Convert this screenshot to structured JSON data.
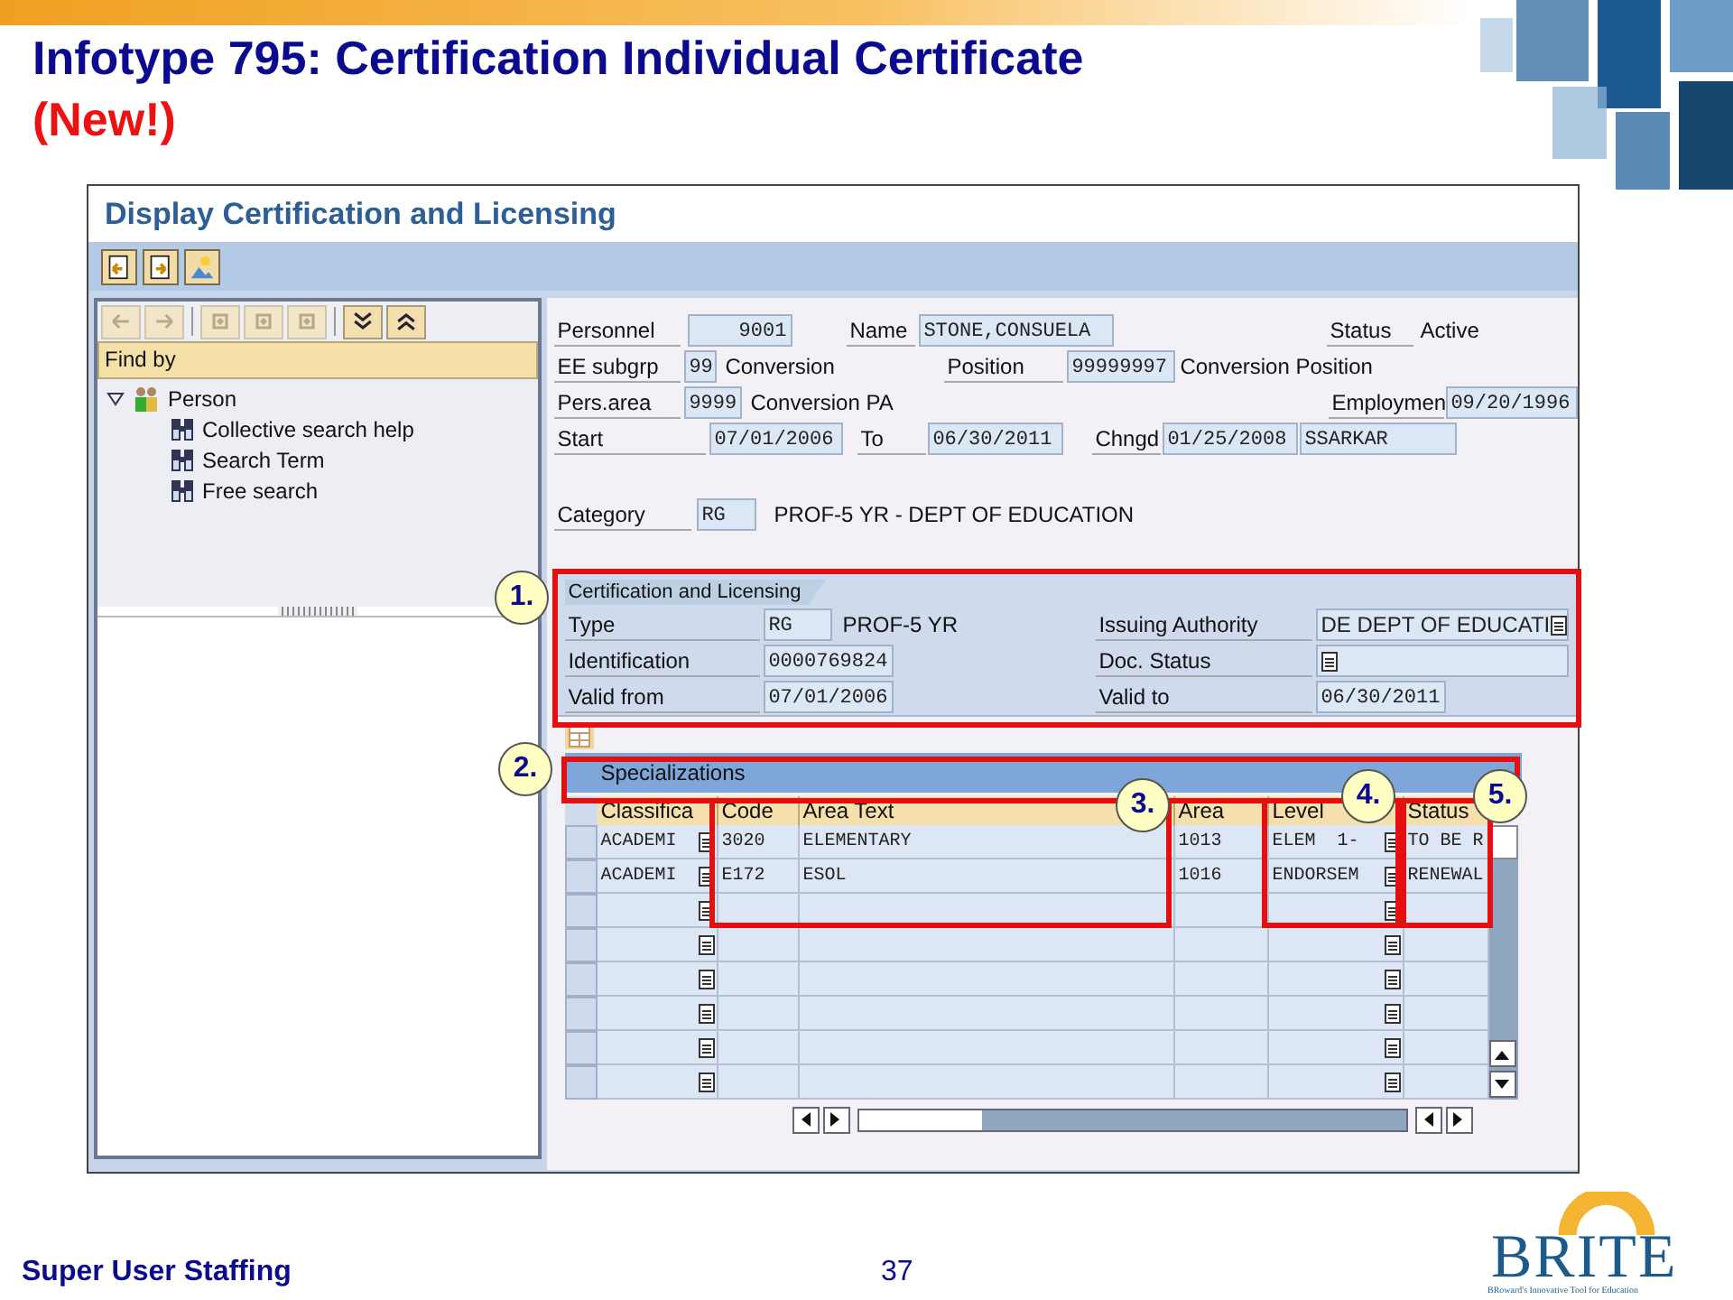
{
  "slide": {
    "title": "Infotype 795: Certification Individual Certificate",
    "subtitle": "(New!)",
    "footer": "Super User Staffing",
    "page_number": "37",
    "logo": {
      "text": "BRITE",
      "tagline": "BRoward's Innovative Tool for Education"
    }
  },
  "window": {
    "title": "Display Certification and Licensing"
  },
  "navigator": {
    "buttons": [
      {
        "kind": "back",
        "disabled": true
      },
      {
        "kind": "forward",
        "disabled": true
      },
      {
        "kind": "node",
        "disabled": true
      },
      {
        "kind": "node",
        "disabled": true
      },
      {
        "kind": "node",
        "disabled": true
      },
      {
        "kind": "expand",
        "disabled": false
      },
      {
        "kind": "collapse",
        "disabled": false
      }
    ],
    "header": "Find by",
    "tree": [
      {
        "label": "Person",
        "expanded": true,
        "children": [
          {
            "label": "Collective search help"
          },
          {
            "label": "Search Term"
          },
          {
            "label": "Free search"
          }
        ]
      }
    ]
  },
  "header": {
    "personnel": {
      "label": "Personnel",
      "value": "9001"
    },
    "name": {
      "label": "Name",
      "value": "STONE,CONSUELA"
    },
    "status": {
      "label": "Status",
      "value": "Active"
    },
    "ee_subgroup": {
      "label": "EE subgrp",
      "value": "99",
      "text": "Conversion"
    },
    "position": {
      "label": "Position",
      "value": "99999997",
      "text": "Conversion Position"
    },
    "pers_area": {
      "label": "Pers.area",
      "value": "9999",
      "text": "Conversion PA"
    },
    "employment": {
      "label": "Employmen",
      "value": "09/20/1996"
    },
    "start": {
      "label": "Start",
      "value": "07/01/2006"
    },
    "to": {
      "label": "To",
      "value": "06/30/2011"
    },
    "changed": {
      "label": "Chngd",
      "value": "01/25/2008",
      "user": "SSARKAR"
    },
    "category": {
      "label": "Category",
      "value": "RG",
      "text": "PROF-5 YR - DEPT OF EDUCATION"
    }
  },
  "certification": {
    "title": "Certification and Licensing",
    "type": {
      "label": "Type",
      "value": "RG",
      "text": "PROF-5 YR"
    },
    "identification": {
      "label": "Identification",
      "value": "0000769824"
    },
    "valid_from": {
      "label": "Valid from",
      "value": "07/01/2006"
    },
    "issuing_authority": {
      "label": "Issuing Authority",
      "value": "DE DEPT OF EDUCATI"
    },
    "doc_status": {
      "label": "Doc. Status"
    },
    "valid_to": {
      "label": "Valid to",
      "value": "06/30/2011"
    }
  },
  "specializations": {
    "title": "Specializations",
    "columns": [
      "Classifica",
      "Code",
      "Area Text",
      "Area",
      "Level",
      "Status"
    ],
    "rows": [
      {
        "kind": "filled",
        "cells": [
          "ACADEMI",
          "3020",
          "ELEMENTARY",
          "1013",
          "ELEM  1-",
          "TO BE R"
        ]
      },
      {
        "kind": "filled",
        "cells": [
          "ACADEMI",
          "E172",
          "ESOL",
          "1016",
          "ENDORSEM",
          "RENEWAL"
        ]
      },
      {
        "kind": "empty"
      },
      {
        "kind": "empty"
      },
      {
        "kind": "empty"
      },
      {
        "kind": "empty"
      },
      {
        "kind": "empty"
      },
      {
        "kind": "empty"
      }
    ]
  },
  "annotations": [
    "1.",
    "2.",
    "3.",
    "4.",
    "5."
  ]
}
